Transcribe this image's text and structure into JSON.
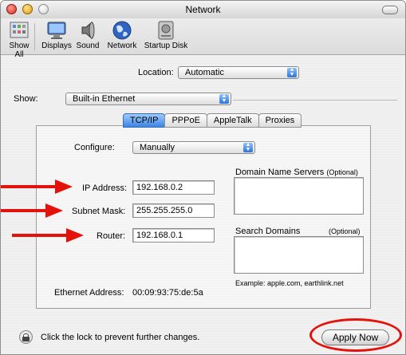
{
  "window": {
    "title": "Network"
  },
  "toolbar": {
    "items": [
      {
        "label": "Show All",
        "icon": "show-all-icon"
      },
      {
        "label": "Displays",
        "icon": "displays-icon"
      },
      {
        "label": "Sound",
        "icon": "sound-icon"
      },
      {
        "label": "Network",
        "icon": "network-globe-icon"
      },
      {
        "label": "Startup Disk",
        "icon": "startup-disk-icon"
      }
    ]
  },
  "location": {
    "label": "Location:",
    "value": "Automatic"
  },
  "show": {
    "label": "Show:",
    "value": "Built-in Ethernet"
  },
  "tabs": [
    "TCP/IP",
    "PPPoE",
    "AppleTalk",
    "Proxies"
  ],
  "tcpip": {
    "configure_label": "Configure:",
    "configure_value": "Manually",
    "ip_label": "IP Address:",
    "ip_value": "192.168.0.2",
    "subnet_label": "Subnet Mask:",
    "subnet_value": "255.255.255.0",
    "router_label": "Router:",
    "router_value": "192.168.0.1",
    "dns_label": "Domain Name Servers",
    "dns_optional": "(Optional)",
    "search_label": "Search Domains",
    "search_optional": "(Optional)",
    "example": "Example: apple.com, earthlink.net",
    "ethernet_label": "Ethernet Address:",
    "ethernet_value": "00:09:93:75:de:5a"
  },
  "footer": {
    "lock_text": "Click the lock to prevent further changes.",
    "apply_label": "Apply Now"
  },
  "colors": {
    "annotation_red": "#e3120b",
    "tab_active": "#3d84e4"
  }
}
